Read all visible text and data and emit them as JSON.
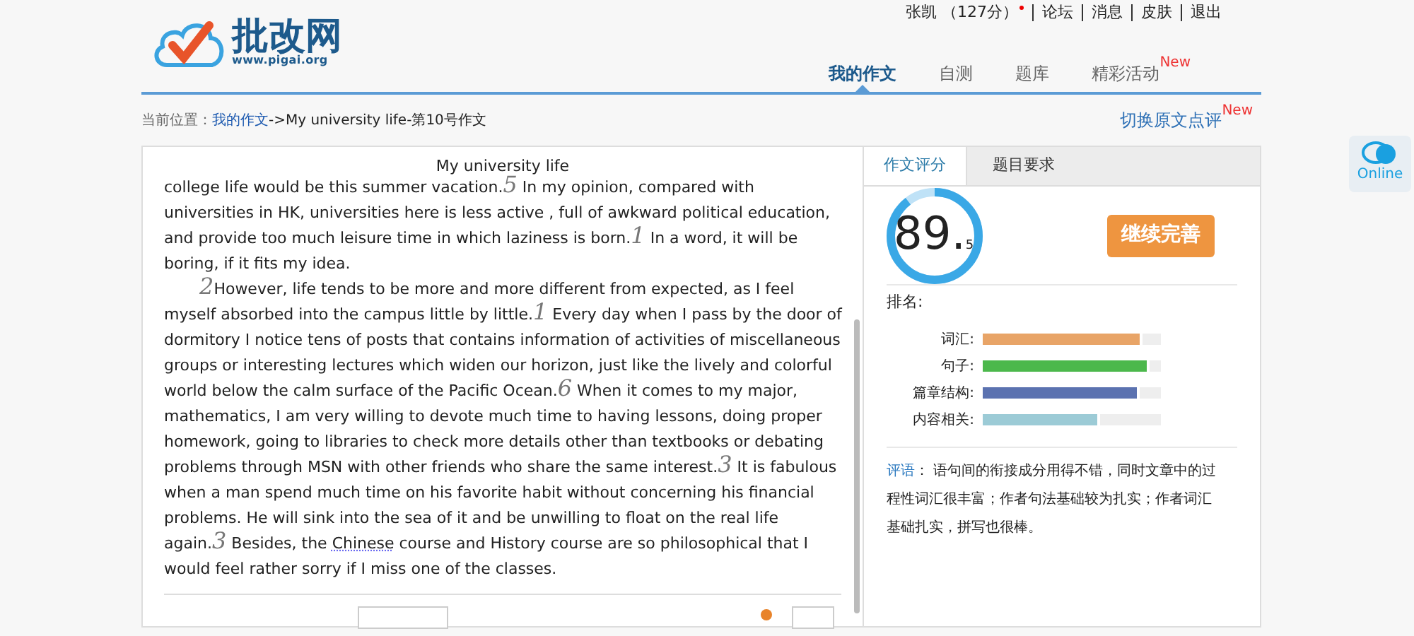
{
  "logo": {
    "name": "批改网",
    "url": "www.pigai.org"
  },
  "user_links": [
    {
      "label": "张凯 （127分）",
      "dot": true
    },
    {
      "label": "论坛",
      "dot": false
    },
    {
      "label": "消息",
      "dot": false
    },
    {
      "label": "皮肤",
      "dot": false
    },
    {
      "label": "退出",
      "dot": false
    }
  ],
  "nav": [
    {
      "label": "我的作文",
      "selected": true
    },
    {
      "label": "自测",
      "selected": false
    },
    {
      "label": "题库",
      "selected": false
    },
    {
      "label": "精彩活动",
      "selected": false,
      "badge": "New"
    }
  ],
  "breadcrumb": {
    "prefix": "当前位置：",
    "link": "我的作文",
    "rest": "->My university life-第10号作文"
  },
  "switch_link": {
    "label": "切换原文点评",
    "badge": "New"
  },
  "essay": {
    "title": "My university life",
    "paragraphs": [
      [
        {
          "kind": "text",
          "text": "college life would be this summer vacation."
        },
        {
          "kind": "mark",
          "text": "5"
        },
        {
          "kind": "text",
          "text": " In my opinion, compared with universities in HK, universities here is less active , full of awkward political education, and provide too much leisure time in which laziness is born."
        },
        {
          "kind": "mark",
          "text": "1"
        },
        {
          "kind": "text",
          "text": " In a word, it will be boring, if it fits my idea."
        }
      ],
      [
        {
          "kind": "mark",
          "text": "2"
        },
        {
          "kind": "text",
          "text": "However, life tends to be more and more different from expected, as I feel myself absorbed into the campus little by little."
        },
        {
          "kind": "mark",
          "text": "1"
        },
        {
          "kind": "text",
          "text": " Every day when I pass by the door of dormitory I notice tens of posts that contains information of activities of miscellaneous groups or interesting lectures which widen our horizon, just like the lively and colorful world below the calm surface of the Pacific Ocean."
        },
        {
          "kind": "mark",
          "text": "6"
        },
        {
          "kind": "text",
          "text": " When it comes to my major, mathematics, I am very willing to devote much time to having lessons, doing proper homework, going to libraries to check more details other than textbooks or debating problems through MSN with other friends who share the same interest."
        },
        {
          "kind": "mark",
          "text": "3"
        },
        {
          "kind": "text",
          "text": " It is fabulous when a man spend much time on his favorite habit without concerning his financial problems. He will sink into the sea of it and be unwilling to float on the real life again."
        },
        {
          "kind": "mark",
          "text": "3"
        },
        {
          "kind": "text",
          "text": " Besides, the "
        },
        {
          "kind": "flagged",
          "text": "Chinese"
        },
        {
          "kind": "text",
          "text": " course and History course are so philosophical that I would feel rather sorry if I miss one of the classes."
        }
      ]
    ]
  },
  "score_tabs": [
    {
      "label": "作文评分",
      "selected": true
    },
    {
      "label": "题目要求",
      "selected": false
    }
  ],
  "score": {
    "whole": "89.",
    "decimal": "5",
    "level": 0.895
  },
  "continue_button": "继续完善",
  "rank_label": "排名:",
  "metrics": [
    {
      "label": "词汇:",
      "level": 0.9,
      "color": "#e8a467"
    },
    {
      "label": "句子:",
      "level": 0.94,
      "color": "#4cb84c"
    },
    {
      "label": "篇章结构:",
      "level": 0.88,
      "color": "#5b72b0"
    },
    {
      "label": "内容相关:",
      "level": 0.66,
      "color": "#9ccbd6"
    }
  ],
  "comment": {
    "label": "评语",
    "text": "：  语句间的衔接成分用得不错，同时文章中的过程性词汇很丰富；作者句法基础较为扎实；作者词汇基础扎实，拼写也很棒。"
  },
  "online": "Online"
}
